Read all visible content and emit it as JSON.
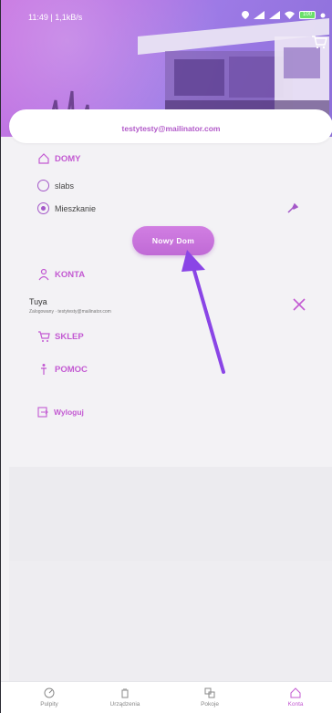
{
  "status_bar": {
    "time": "11:49 | 1,1kB/s",
    "battery": "100"
  },
  "header": {
    "email": "testytesty@mailinator.com"
  },
  "homes": {
    "title": "DOMY",
    "items": [
      {
        "label": "slabs",
        "selected": false
      },
      {
        "label": "Mieszkanie",
        "selected": true
      }
    ],
    "new_button": "Nowy Dom"
  },
  "accounts": {
    "title": "KONTA",
    "account_name": "Tuya",
    "account_status": "Zalogowany · testytesty@mailinator.com"
  },
  "menu": {
    "shop": "SKLEP",
    "help": "POMOC",
    "logout": "Wyloguj"
  },
  "bottom_nav": {
    "items": [
      {
        "label": "Pulpity",
        "icon": "dashboard-icon"
      },
      {
        "label": "Urządzenia",
        "icon": "device-icon"
      },
      {
        "label": "Pokoje",
        "icon": "rooms-icon"
      },
      {
        "label": "Konta",
        "icon": "home-icon",
        "active": true
      }
    ]
  },
  "colors": {
    "accent": "#c35ad2",
    "button": "#c86fdb",
    "arrow": "#8a45e6"
  }
}
